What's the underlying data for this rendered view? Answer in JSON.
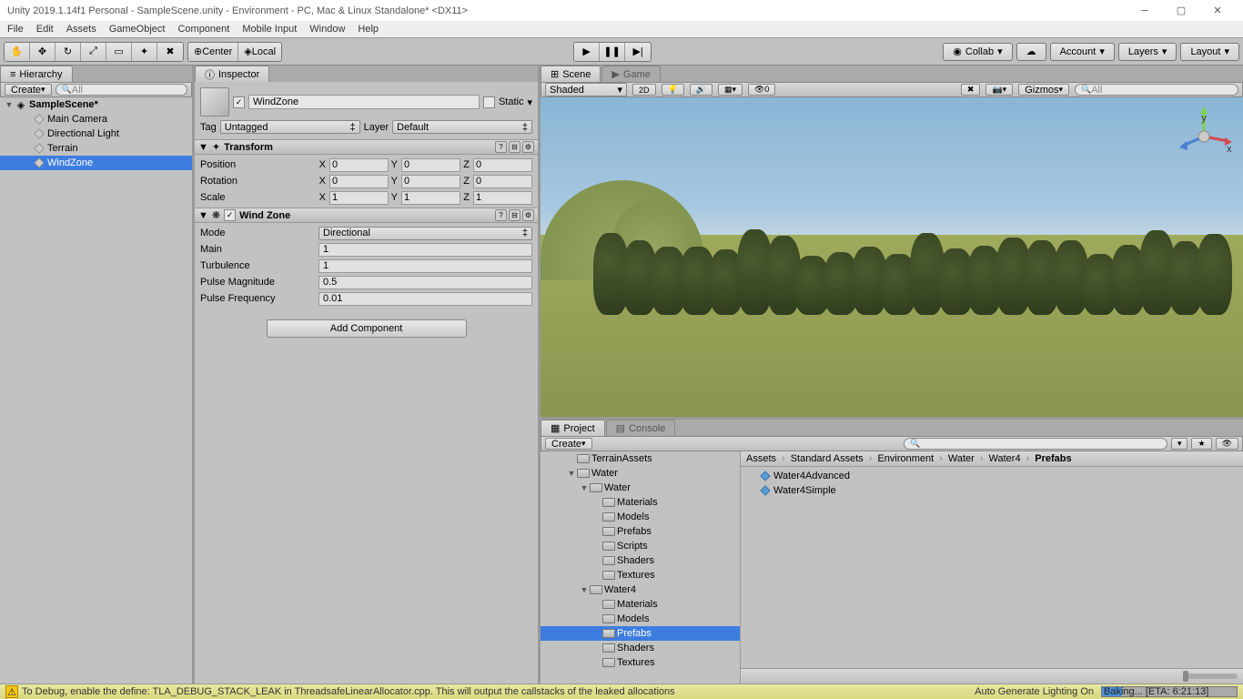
{
  "window": {
    "title": "Unity 2019.1.14f1 Personal - SampleScene.unity - Environment - PC, Mac & Linux Standalone* <DX11>"
  },
  "menu": [
    "File",
    "Edit",
    "Assets",
    "GameObject",
    "Component",
    "Mobile Input",
    "Window",
    "Help"
  ],
  "toolbar": {
    "center": "Center",
    "local": "Local",
    "collab": "Collab",
    "account": "Account",
    "layers": "Layers",
    "layout": "Layout"
  },
  "hierarchy": {
    "title": "Hierarchy",
    "create": "Create",
    "search_placeholder": "All",
    "scene": "SampleScene*",
    "items": [
      {
        "name": "Main Camera",
        "selected": false
      },
      {
        "name": "Directional Light",
        "selected": false
      },
      {
        "name": "Terrain",
        "selected": false
      },
      {
        "name": "WindZone",
        "selected": true
      }
    ]
  },
  "inspector": {
    "title": "Inspector",
    "go_name": "WindZone",
    "static": "Static",
    "tag_label": "Tag",
    "tag_value": "Untagged",
    "layer_label": "Layer",
    "layer_value": "Default",
    "transform": {
      "title": "Transform",
      "position": {
        "x": "0",
        "y": "0",
        "z": "0"
      },
      "rotation": {
        "x": "0",
        "y": "0",
        "z": "0"
      },
      "scale": {
        "x": "1",
        "y": "1",
        "z": "1"
      },
      "labels": {
        "position": "Position",
        "rotation": "Rotation",
        "scale": "Scale"
      }
    },
    "windzone": {
      "title": "Wind Zone",
      "mode_label": "Mode",
      "mode_value": "Directional",
      "main_label": "Main",
      "main_value": "1",
      "turb_label": "Turbulence",
      "turb_value": "1",
      "pmag_label": "Pulse Magnitude",
      "pmag_value": "0.5",
      "pfreq_label": "Pulse Frequency",
      "pfreq_value": "0.01"
    },
    "add_component": "Add Component"
  },
  "scene": {
    "tab_scene": "Scene",
    "tab_game": "Game",
    "shaded": "Shaded",
    "twod": "2D",
    "gizmos": "Gizmos",
    "search_placeholder": "All"
  },
  "project": {
    "tab_project": "Project",
    "tab_console": "Console",
    "create": "Create",
    "tree": [
      {
        "indent": 2,
        "name": "TerrainAssets",
        "type": "folder"
      },
      {
        "indent": 2,
        "name": "Water",
        "type": "folder",
        "open": true
      },
      {
        "indent": 3,
        "name": "Water",
        "type": "folder",
        "open": true
      },
      {
        "indent": 4,
        "name": "Materials",
        "type": "folder"
      },
      {
        "indent": 4,
        "name": "Models",
        "type": "folder"
      },
      {
        "indent": 4,
        "name": "Prefabs",
        "type": "folder"
      },
      {
        "indent": 4,
        "name": "Scripts",
        "type": "folder"
      },
      {
        "indent": 4,
        "name": "Shaders",
        "type": "folder"
      },
      {
        "indent": 4,
        "name": "Textures",
        "type": "folder"
      },
      {
        "indent": 3,
        "name": "Water4",
        "type": "folder",
        "open": true
      },
      {
        "indent": 4,
        "name": "Materials",
        "type": "folder"
      },
      {
        "indent": 4,
        "name": "Models",
        "type": "folder"
      },
      {
        "indent": 4,
        "name": "Prefabs",
        "type": "folder",
        "selected": true
      },
      {
        "indent": 4,
        "name": "Shaders",
        "type": "folder"
      },
      {
        "indent": 4,
        "name": "Textures",
        "type": "folder"
      }
    ],
    "breadcrumb": [
      "Assets",
      "Standard Assets",
      "Environment",
      "Water",
      "Water4",
      "Prefabs"
    ],
    "items": [
      "Water4Advanced",
      "Water4Simple"
    ]
  },
  "status": {
    "message": "To Debug, enable the define: TLA_DEBUG_STACK_LEAK in ThreadsafeLinearAllocator.cpp. This will output the callstacks of the leaked allocations",
    "light": "Auto Generate Lighting On",
    "baking": "Baking... [ETA: 6:21:13]"
  }
}
